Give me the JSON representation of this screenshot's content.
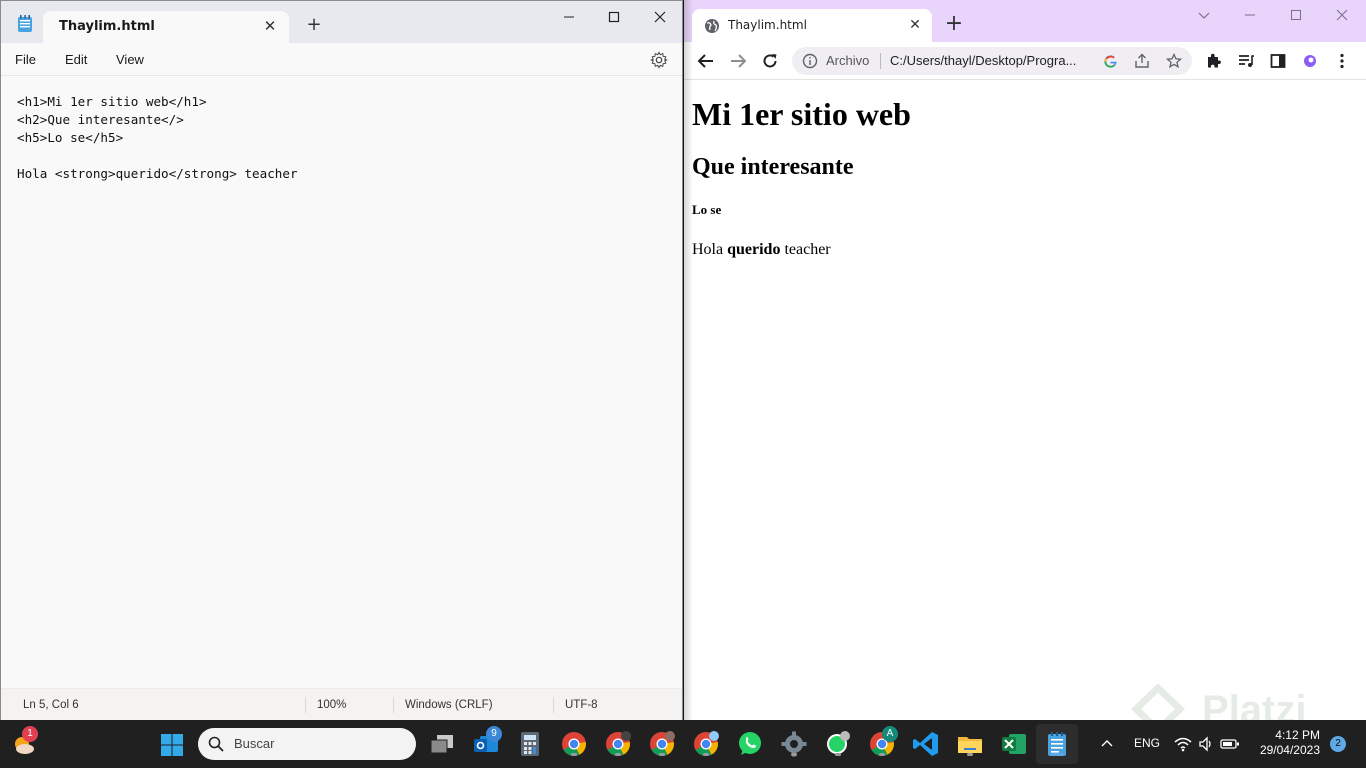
{
  "notepad": {
    "tab_title": "Thaylim.html",
    "tab_close": "✕",
    "new_tab": "+",
    "menu": [
      "File",
      "Edit",
      "View"
    ],
    "editor_lines": [
      "<h1>Mi 1er sitio web</h1>",
      "<h2>Que interesante</>",
      "<h5>Lo se</h5>",
      "",
      "Hola <strong>querido</strong> teacher"
    ],
    "status": {
      "position": "Ln 5, Col 6",
      "zoom": "100%",
      "line_ending": "Windows (CRLF)",
      "encoding": "UTF-8"
    }
  },
  "chrome": {
    "tab_title": "Thaylim.html",
    "tab_close": "✕",
    "new_tab": "+",
    "scheme_label": "Archivo",
    "url": "C:/Users/thayl/Desktop/Progra...",
    "page": {
      "h1": "Mi 1er sitio web",
      "h2": "Que interesante",
      "h5": "Lo se",
      "p_before": "Hola ",
      "p_strong": "querido",
      "p_after": " teacher"
    }
  },
  "watermark": {
    "text": "Platzi"
  },
  "taskbar": {
    "weather_badge": "1",
    "search_placeholder": "Buscar",
    "outlook_badge": "9",
    "chrome_profile_badge": "A",
    "language": "ENG",
    "time": "4:12 PM",
    "date": "29/04/2023",
    "notification_count": "2"
  },
  "colors": {
    "chrome_frame": "#e9d5fb",
    "notepad_frame": "#e7e9ee",
    "taskbar": "#202020"
  }
}
